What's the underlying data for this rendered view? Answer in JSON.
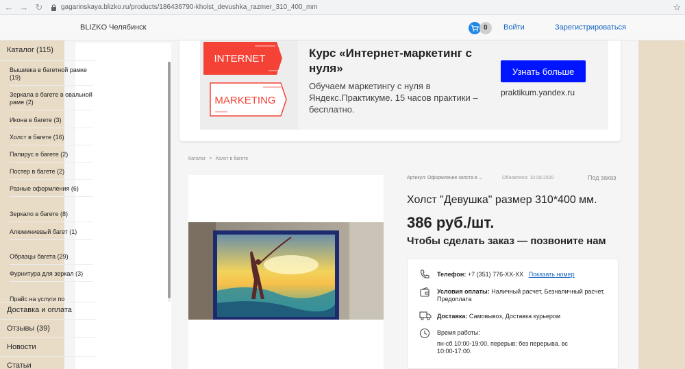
{
  "browser": {
    "url": "gagarinskaya.blizko.ru/products/186436790-kholst_devushka_razmer_310_400_mm"
  },
  "header": {
    "brand": "BLIZKO Челябинск",
    "cart_count": "0",
    "login": "Войти",
    "register": "Зарегистрироваться"
  },
  "sidebar": {
    "catalog": "Каталог (115)",
    "subitems": [
      "Вышивка в багетной рамке (19)",
      "Зеркала в багете в овальной раме (2)",
      "Икона в багете (3)",
      "Холст в багете (16)",
      "Папирус в багете (2)",
      "Постер в багете (2)",
      "Разные оформления (6)",
      "Зеркало в багете (8)",
      "Алюминиевый багет (1)",
      "Образцы багета (29)",
      "Фурнитура для зеркал (3)",
      "Прайс на услуги по"
    ],
    "delivery": "Доставка и оплата",
    "reviews": "Отзывы (39)",
    "news": "Новости",
    "articles": "Статьи"
  },
  "ad": {
    "img_word1": "INTERNET",
    "img_word2": "MARKETING",
    "title": "Курс «Интернет-маркетинг с нуля»",
    "text": "Обучаем маркетингу с нуля в Яндекс.Практикуме. 15 часов практики – бесплатно.",
    "button": "Узнать больше",
    "domain": "praktikum.yandex.ru",
    "colors": {
      "button": "#0015ff",
      "accent": "#f44336"
    }
  },
  "breadcrumb": {
    "items": [
      "Каталог",
      ">",
      "Холст в багете"
    ]
  },
  "product": {
    "article": "Артикул: Оформление холста в ...",
    "updated": "Обновлено: 10.08.2020",
    "availability": "Под заказ",
    "title": "Холст \"Девушка\" размер 310*400 мм.",
    "price": "386 руб./шт.",
    "call_to_order": "Чтобы сделать заказ — позвоните нам"
  },
  "contacts": {
    "phone_label": "Телефон:",
    "phone": "+7 (351) 776-XX-XX",
    "show_number": "Показать номер",
    "payment_label": "Условия оплаты:",
    "payment": "Наличный расчет, Безналичный расчет, Предоплата",
    "delivery_label": "Доставка:",
    "delivery": "Самовывоз, Доставка курьером",
    "hours_label": "Время работы:",
    "hours": "пн-сб 10:00-19:00, перерыв: без перерыва. вс 10:00-17:00."
  }
}
